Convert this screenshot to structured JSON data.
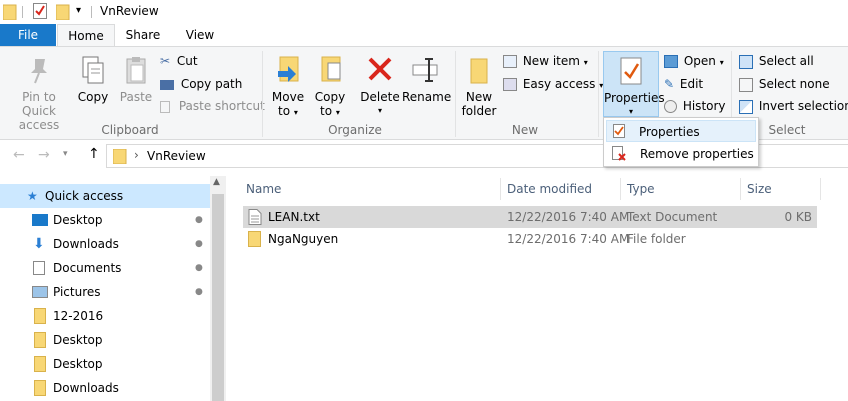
{
  "window": {
    "title": "VnReview"
  },
  "tabs": {
    "file": "File",
    "home": "Home",
    "share": "Share",
    "view": "View"
  },
  "clipboard": {
    "pin": "Pin to Quick",
    "pin2": "access",
    "copy": "Copy",
    "paste": "Paste",
    "cut": "Cut",
    "copy_path": "Copy path",
    "paste_shortcut": "Paste shortcut",
    "group": "Clipboard"
  },
  "organize": {
    "move": "Move",
    "move2": "to",
    "copy": "Copy",
    "copy2": "to",
    "delete": "Delete",
    "rename": "Rename",
    "group": "Organize"
  },
  "new": {
    "new": "New",
    "folder": "folder",
    "new_item": "New item",
    "easy_access": "Easy access",
    "group": "New"
  },
  "open": {
    "properties": "Properties",
    "open": "Open",
    "edit": "Edit",
    "history": "History"
  },
  "select": {
    "all": "Select all",
    "none": "Select none",
    "invert": "Invert selection",
    "group": "Select"
  },
  "dropdown": {
    "properties": "Properties",
    "remove": "Remove properties"
  },
  "address": {
    "arrow": "›",
    "path": "VnReview"
  },
  "nav": [
    {
      "label": "Quick access",
      "icon": "star-icon"
    },
    {
      "label": "Desktop",
      "icon": "desktop-icon",
      "pinned": true
    },
    {
      "label": "Downloads",
      "icon": "download-icon",
      "pinned": true
    },
    {
      "label": "Documents",
      "icon": "documents-icon",
      "pinned": true
    },
    {
      "label": "Pictures",
      "icon": "pictures-icon",
      "pinned": true
    },
    {
      "label": "12-2016",
      "icon": "folder-icon"
    },
    {
      "label": "Desktop",
      "icon": "folder-icon"
    },
    {
      "label": "Desktop",
      "icon": "folder-icon"
    },
    {
      "label": "Downloads",
      "icon": "folder-icon"
    }
  ],
  "columns": {
    "name": "Name",
    "date": "Date modified",
    "type": "Type",
    "size": "Size"
  },
  "files": [
    {
      "name": "LEAN.txt",
      "date": "12/22/2016 7:40 AM",
      "type": "Text Document",
      "size": "0 KB",
      "selected": true
    },
    {
      "name": "NgaNguyen",
      "date": "12/22/2016 7:40 AM",
      "type": "File folder",
      "size": ""
    }
  ],
  "colors": {
    "accent": "#1979ca",
    "selected_row": "#d9d9d9",
    "folder": "#f8d775"
  }
}
